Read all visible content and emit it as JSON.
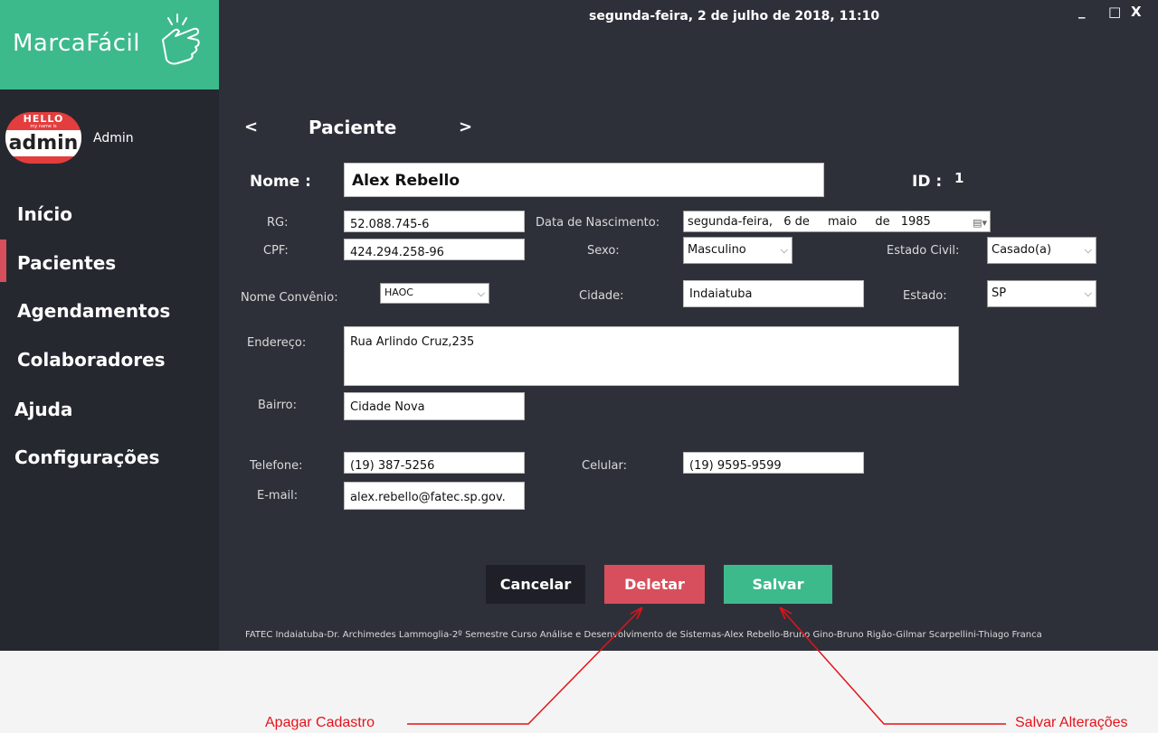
{
  "app": {
    "name": "MarcaFácil",
    "datetime": "segunda-feira, 2 de julho de 2018, 11:10"
  },
  "colors": {
    "accent": "#3dba8c",
    "danger": "#d74f5c",
    "sidebar": "#262830",
    "main": "#2e3039",
    "annotation": "#e3131b"
  },
  "window": {
    "minimize": "_",
    "maximize": "□",
    "close": "X"
  },
  "user": {
    "badge_hello": "HELLO",
    "badge_sub": "my name is",
    "badge_name": "admin",
    "name": "Admin"
  },
  "nav": {
    "inicio": "Início",
    "pacientes": "Pacientes",
    "agendamentos": "Agendamentos",
    "colaboradores": "Colaboradores",
    "ajuda": "Ajuda",
    "configuracoes": "Configurações",
    "active": "Pacientes"
  },
  "page": {
    "prev": "<",
    "next": ">",
    "title": "Paciente"
  },
  "form": {
    "nome_label": "Nome :",
    "nome": "Alex Rebello",
    "id_label": "ID :",
    "id": "1",
    "rg_label": "RG:",
    "rg": "52.088.745-6",
    "nascimento_label": "Data de Nascimento:",
    "nasc_weekday": "segunda-feira,",
    "nasc_day": "6 de",
    "nasc_month": "maio",
    "nasc_de": "de",
    "nasc_year": "1985",
    "cpf_label": "CPF:",
    "cpf": "424.294.258-96",
    "sexo_label": "Sexo:",
    "sexo": "Masculino",
    "estado_civil_label": "Estado Civil:",
    "estado_civil": "Casado(a)",
    "convenio_label": "Nome Convênio:",
    "convenio": "HAOC",
    "cidade_label": "Cidade:",
    "cidade": "Indaiatuba",
    "estado_label": "Estado:",
    "estado": "SP",
    "endereco_label": "Endereço:",
    "endereco": "Rua Arlindo Cruz,235",
    "bairro_label": "Bairro:",
    "bairro": "Cidade Nova",
    "telefone_label": "Telefone:",
    "telefone": "(19)  387-5256",
    "celular_label": "Celular:",
    "celular": "(19)  9595-9599",
    "email_label": "E-mail:",
    "email": "alex.rebello@fatec.sp.gov."
  },
  "buttons": {
    "cancelar": "Cancelar",
    "deletar": "Deletar",
    "salvar": "Salvar"
  },
  "footer": "FATEC Indaiatuba-Dr. Archimedes Lammoglia-2º Semestre Curso Análise e Desenvolvimento de Sistemas-Alex Rebello-Bruno Gino-Bruno Rigão-Gilmar Scarpellini-Thiago Franca",
  "annotations": {
    "apagar": "Apagar Cadastro",
    "salvar": "Salvar Alterações"
  }
}
